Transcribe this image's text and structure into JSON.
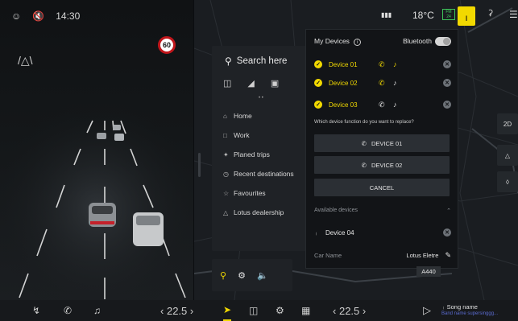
{
  "status": {
    "time": "14:30",
    "temperature": "18°C",
    "fm": "FM\n24"
  },
  "drive": {
    "speed_limit": "60"
  },
  "search": {
    "placeholder": "Search here",
    "nav_items": [
      {
        "icon": "home-icon",
        "label": "Home"
      },
      {
        "icon": "work-icon",
        "label": "Work"
      },
      {
        "icon": "planed-trips-icon",
        "label": "Planed trips"
      },
      {
        "icon": "recent-icon",
        "label": "Recent destinations"
      },
      {
        "icon": "star-icon",
        "label": "Favourites"
      },
      {
        "icon": "dealership-icon",
        "label": "Lotus dealership"
      }
    ]
  },
  "devices": {
    "title": "My Devices",
    "bluetooth_label": "Bluetooth",
    "connected": [
      {
        "name": "Device 01",
        "highlight": true
      },
      {
        "name": "Device 02",
        "highlight": true
      },
      {
        "name": "Device 03",
        "highlight": false
      }
    ],
    "question": "Which device function do you want to replace?",
    "replace_buttons": [
      "DEVICE 01",
      "DEVICE 02"
    ],
    "cancel_label": "CANCEL",
    "available_label": "Available devices",
    "available": [
      {
        "name": "Device 04"
      }
    ],
    "car_name_label": "Car Name",
    "car_name_value": "Lotus Eletre"
  },
  "map": {
    "view_mode": "2D",
    "road_label": "A440"
  },
  "bottom": {
    "temp_left": "22.5",
    "temp_right": "22.5",
    "song_title": "Song name",
    "song_artist": "Band name supersinggg..."
  },
  "colors": {
    "accent": "#f2d900",
    "panel": "#121417",
    "background": "#0b0d10"
  }
}
